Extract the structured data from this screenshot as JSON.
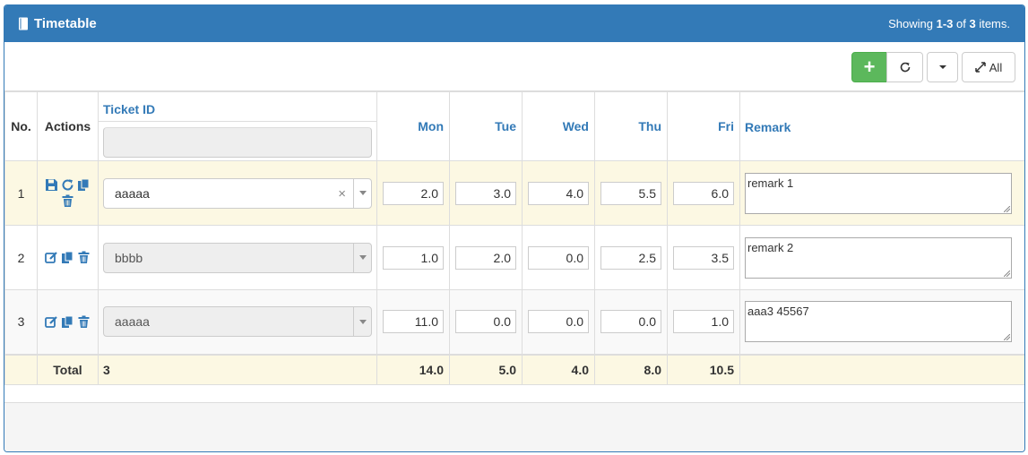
{
  "header": {
    "title": "Timetable",
    "summary_prefix": "Showing ",
    "summary_range": "1-3",
    "summary_mid": " of ",
    "summary_total": "3",
    "summary_suffix": " items."
  },
  "toolbar": {
    "all_label": "All"
  },
  "columns": {
    "no": "No.",
    "actions": "Actions",
    "ticket": "Ticket ID",
    "mon": "Mon",
    "tue": "Tue",
    "wed": "Wed",
    "thu": "Thu",
    "fri": "Fri",
    "remark": "Remark"
  },
  "rows": [
    {
      "no": "1",
      "ticket": "aaaaa",
      "mon": "2.0",
      "tue": "3.0",
      "wed": "4.0",
      "thu": "5.5",
      "fri": "6.0",
      "remark": "remark 1"
    },
    {
      "no": "2",
      "ticket": "bbbb",
      "mon": "1.0",
      "tue": "2.0",
      "wed": "0.0",
      "thu": "2.5",
      "fri": "3.5",
      "remark": "remark 2"
    },
    {
      "no": "3",
      "ticket": "aaaaa",
      "mon": "11.0",
      "tue": "0.0",
      "wed": "0.0",
      "thu": "0.0",
      "fri": "1.0",
      "remark": "aaa3 45567"
    }
  ],
  "footer": {
    "label": "Total",
    "count": "3",
    "mon": "14.0",
    "tue": "5.0",
    "wed": "4.0",
    "thu": "8.0",
    "fri": "10.5"
  },
  "colors": {
    "primary": "#337ab7",
    "success": "#5cb85c",
    "edit_row": "#fcf8e3"
  }
}
